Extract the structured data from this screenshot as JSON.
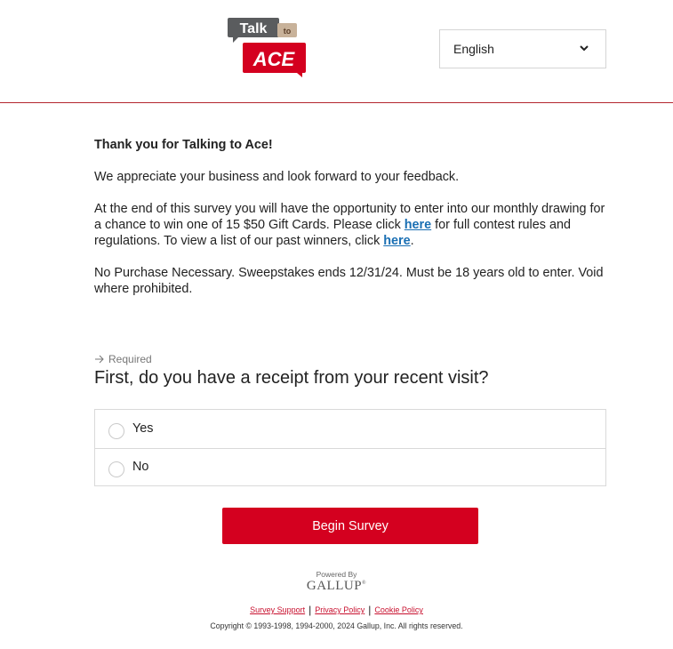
{
  "header": {
    "logo": {
      "talk": "Talk",
      "to": "to",
      "ace": "ACE"
    },
    "language_select": {
      "value": "English",
      "icon": "chevron-down-icon"
    }
  },
  "intro": {
    "title": "Thank you for Talking to Ace!",
    "appreciation": "We appreciate your business and look forward to your feedback.",
    "contest_part1": "At the end of this survey you will have the opportunity to enter into our monthly drawing for a chance to win one of 15 $50 Gift Cards. Please click ",
    "contest_link1": "here",
    "contest_part2": " for full contest rules and regulations. To view a list of our past winners, click ",
    "contest_link2": "here",
    "contest_part3": ".",
    "disclaimer": "No Purchase Necessary. Sweepstakes ends 12/31/24. Must be 18 years old to enter. Void where prohibited."
  },
  "question": {
    "required_label": "Required",
    "required_icon": "arrow-right-icon",
    "text": "First, do you have a receipt from your recent visit?",
    "options": [
      "Yes",
      "No"
    ]
  },
  "begin_button": "Begin Survey",
  "footer": {
    "powered_by": "Powered By",
    "brand": "GALLUP",
    "brand_mark": "®",
    "links": [
      "Survey Support",
      "Privacy Policy",
      "Cookie Policy"
    ],
    "copyright": "Copyright © 1993-1998, 1994-2000, 2024 Gallup, Inc. All rights reserved."
  },
  "colors": {
    "accent_red": "#d4001f",
    "divider_red": "#b3262f",
    "link_blue": "#1a6fb3",
    "logo_gray": "#5a5c5e",
    "logo_tan": "#c8b29a"
  }
}
